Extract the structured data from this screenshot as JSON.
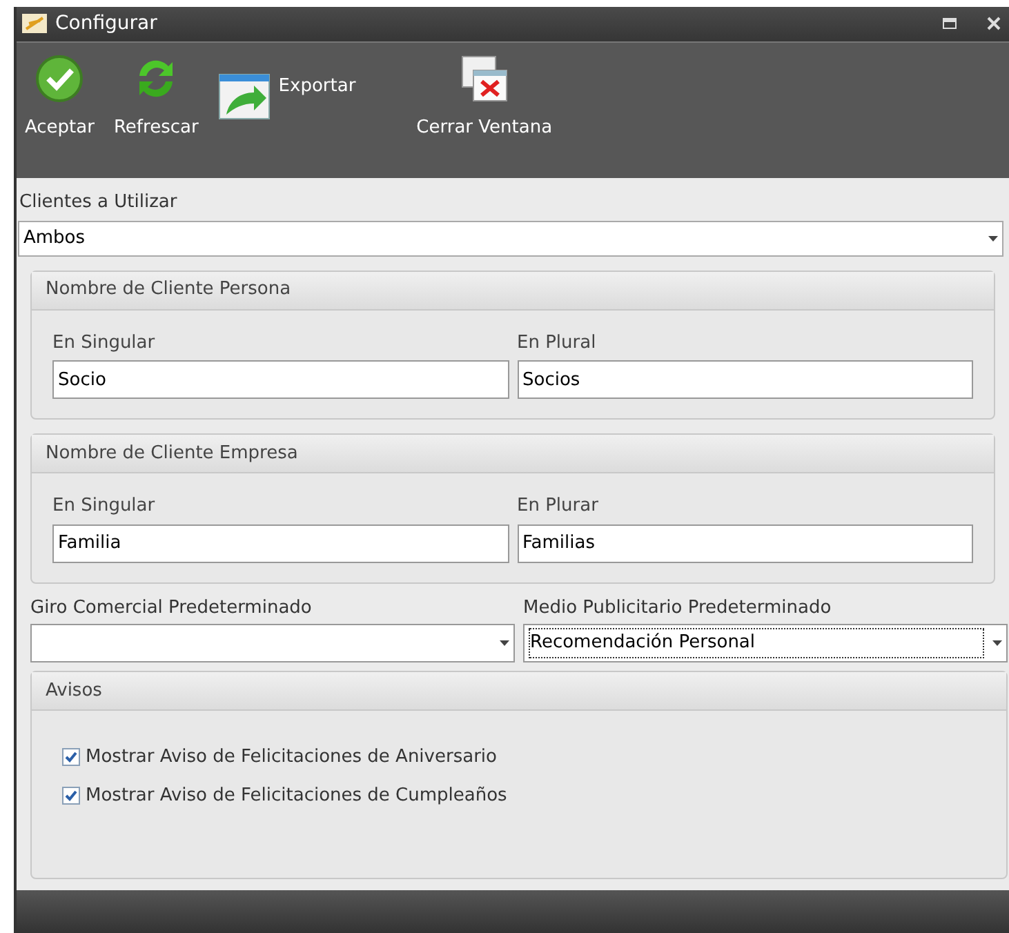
{
  "window": {
    "title": "Configurar"
  },
  "toolbar": [
    {
      "label": "Aceptar",
      "kind": "stacked"
    },
    {
      "label": "Refrescar",
      "kind": "stacked"
    },
    {
      "label": "Exportar",
      "kind": "inline"
    },
    {
      "label": "Cerrar Ventana",
      "kind": "stacked"
    }
  ],
  "clients": {
    "label": "Clientes a Utilizar",
    "value": "Ambos"
  },
  "groups": [
    {
      "title": "Nombre de Cliente Persona",
      "fields": [
        {
          "label": "En Singular",
          "value": "Socio"
        },
        {
          "label": "En Plural",
          "value": "Socios"
        }
      ]
    },
    {
      "title": "Nombre de Cliente Empresa",
      "fields": [
        {
          "label": "En Singular",
          "value": "Familia"
        },
        {
          "label": "En Plurar",
          "value": "Familias"
        }
      ]
    }
  ],
  "defaults": [
    {
      "label": "Giro Comercial Predeterminado",
      "focused": false
    },
    {
      "label": "Medio Publicitario Predeterminado",
      "value": "Recomendación Personal",
      "focused": true
    }
  ],
  "notices": {
    "title": "Avisos",
    "items": [
      {
        "label": "Mostrar Aviso de Felicitaciones de Aniversario",
        "checked": true
      },
      {
        "label": "Mostrar Aviso de Felicitaciones de Cumpleaños",
        "checked": true
      }
    ]
  }
}
